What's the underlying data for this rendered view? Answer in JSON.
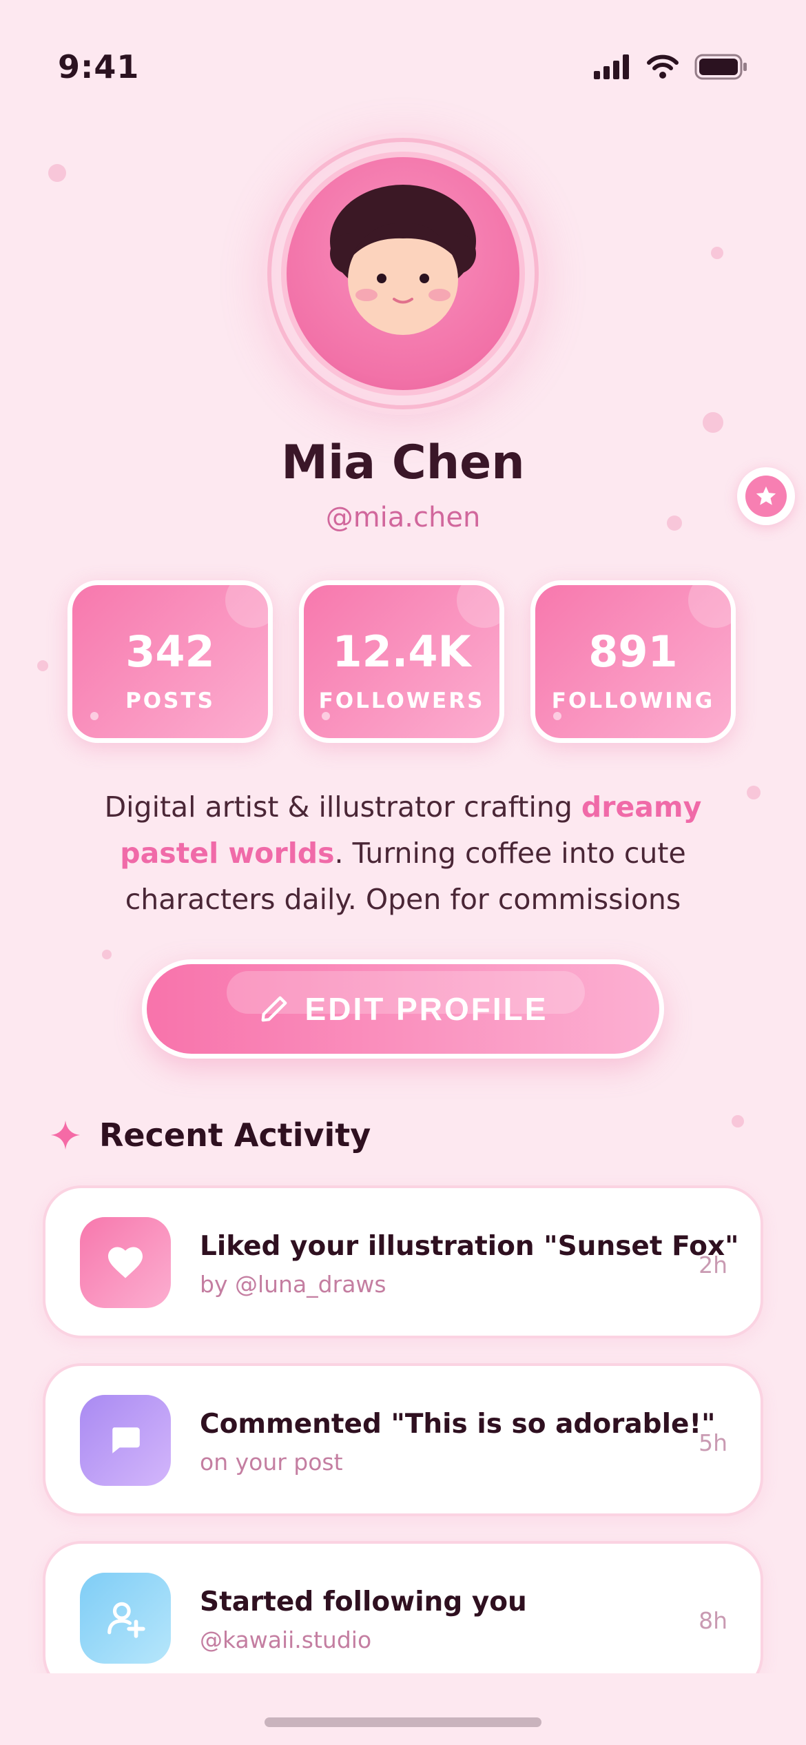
{
  "status_bar": {
    "time": "9:41"
  },
  "profile": {
    "name": "Mia Chen",
    "handle": "@mia.chen"
  },
  "stats": [
    {
      "value": "342",
      "label": "POSTS"
    },
    {
      "value": "12.4K",
      "label": "FOLLOWERS"
    },
    {
      "value": "891",
      "label": "FOLLOWING"
    }
  ],
  "bio": {
    "part1": "Digital artist & illustrator crafting ",
    "highlight": "dreamy pastel worlds",
    "part2": ". Turning coffee into cute characters daily. Open for commissions"
  },
  "edit_button": {
    "label": "EDIT PROFILE"
  },
  "activity": {
    "title": "Recent Activity",
    "items": [
      {
        "icon": "heart-icon",
        "color": "#f77fb2",
        "title": "Liked your illustration \"Sunset Fox\"",
        "subtitle": "by @luna_draws",
        "time": "2h"
      },
      {
        "icon": "comment-icon",
        "color": "#b892f5",
        "title": "Commented \"This is so adorable!\"",
        "subtitle": "on your post",
        "time": "5h"
      },
      {
        "icon": "add-user-icon",
        "color": "#8fd4f7",
        "title": "Started following you",
        "subtitle": "@kawaii.studio",
        "time": "8h"
      }
    ]
  },
  "colors": {
    "accent": "#f77fb2",
    "background": "#fde8f0"
  }
}
